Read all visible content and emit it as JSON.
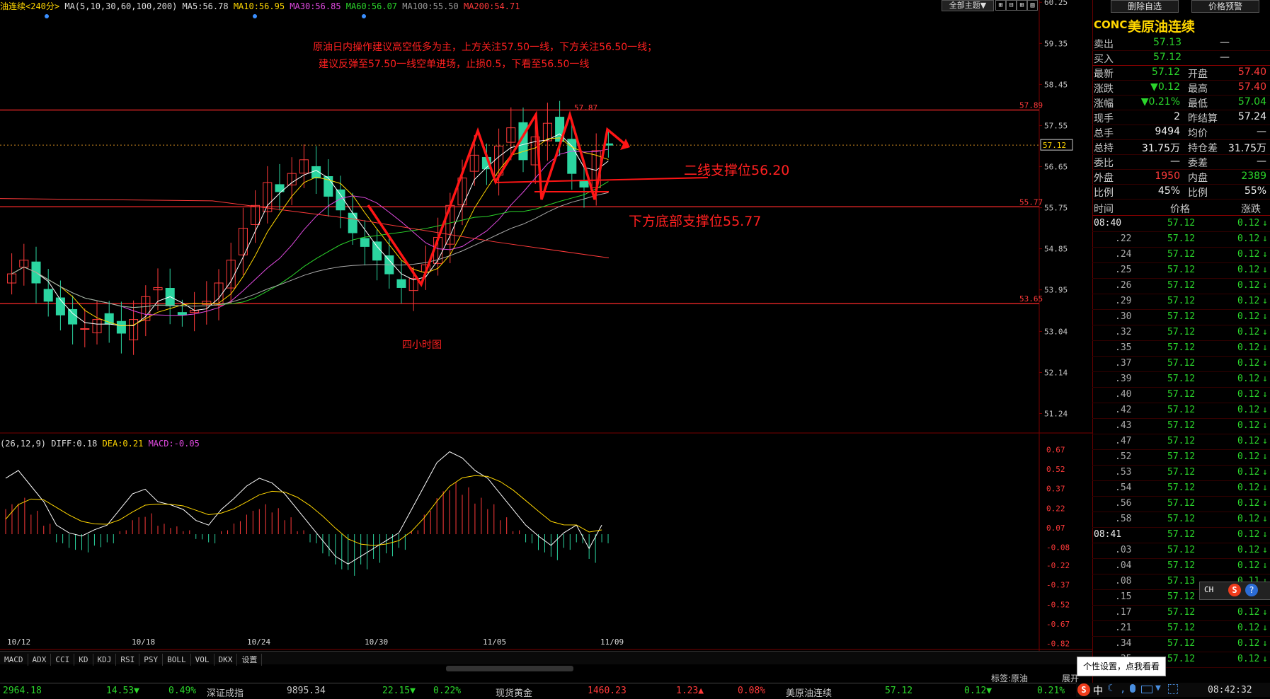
{
  "chart_header": {
    "name": "油连续<240分>",
    "ma_label": "MA(5,10,30,60,100,200)",
    "ma5": "MA5:56.78",
    "ma10": "MA10:56.95",
    "ma30": "MA30:56.85",
    "ma60": "MA60:56.07",
    "ma100": "MA100:55.50",
    "ma200": "MA200:54.71",
    "theme_btn": "全部主题▼"
  },
  "annotations": {
    "line1": "原油日内操作建议高空低多为主，上方关注57.50一线，下方关注56.50一线；",
    "line2": "建议反弹至57.50一线空单进场，止损0.5，下看至56.50一线",
    "support1": "二线支撑位56.20",
    "support2": "下方底部支撑位55.77",
    "chart_label": "四小时图",
    "high_label": "57.87"
  },
  "chart_data": [
    {
      "type": "candlestick",
      "title": "油连续<240分>",
      "yaxis_ticks": [
        "60.25",
        "59.35",
        "58.45",
        "57.55",
        "56.65",
        "55.75",
        "54.85",
        "53.95",
        "53.04",
        "52.14",
        "51.24"
      ],
      "xaxis_ticks": [
        "10/12",
        "10/18",
        "10/24",
        "10/30",
        "11/05",
        "11/09"
      ],
      "ylim": [
        51.0,
        60.3
      ],
      "hlines": [
        {
          "value": 57.89,
          "label": "57.89"
        },
        {
          "value": 55.77,
          "label": "55.77"
        },
        {
          "value": 53.65,
          "label": "53.65"
        }
      ],
      "last_price": "57.12",
      "close_series": [
        54.3,
        54.6,
        54.1,
        53.7,
        53.4,
        53.2,
        53.1,
        53.3,
        53.2,
        53.0,
        53.3,
        53.8,
        54.0,
        53.6,
        53.4,
        53.5,
        53.7,
        54.1,
        54.6,
        55.3,
        55.8,
        56.3,
        56.1,
        56.5,
        56.8,
        56.4,
        56.0,
        55.7,
        55.2,
        54.9,
        54.6,
        54.3,
        54.0,
        54.2,
        54.5,
        55.1,
        55.8,
        56.4,
        56.9,
        56.6,
        57.1,
        57.5,
        56.8,
        57.3,
        57.6,
        57.2,
        56.5,
        56.2,
        57.0,
        57.12
      ]
    },
    {
      "type": "bar",
      "title": "MACD",
      "series": [
        {
          "name": "MACD",
          "values": [
            0.25,
            0.3,
            0.2,
            0.1,
            -0.05,
            -0.1,
            -0.12,
            -0.08,
            -0.05,
            0.05,
            0.15,
            0.18,
            0.1,
            0.08,
            0.05,
            -0.02,
            -0.05,
            0.05,
            0.12,
            0.2,
            0.25,
            0.22,
            0.15,
            0.05,
            -0.05,
            -0.15,
            -0.25,
            -0.3,
            -0.25,
            -0.2,
            -0.15,
            -0.1,
            0.05,
            0.2,
            0.35,
            0.42,
            0.38,
            0.3,
            0.25,
            0.15,
            0.05,
            -0.05,
            -0.12,
            -0.18,
            -0.1,
            -0.05,
            -0.2,
            -0.05
          ]
        }
      ],
      "yaxis_ticks": [
        "0.67",
        "0.52",
        "0.37",
        "0.22",
        "0.07",
        "-0.08",
        "-0.22",
        "-0.37",
        "-0.52",
        "-0.67",
        "-0.82"
      ],
      "ylim": [
        -0.85,
        0.7
      ]
    }
  ],
  "macd_header": {
    "params": "(26,12,9)",
    "diff": "DIFF:0.18",
    "dea": "DEA:0.21",
    "macd": "MACD:-0.05"
  },
  "tabs": [
    "MACD",
    "ADX",
    "CCI",
    "KD",
    "KDJ",
    "RSI",
    "PSY",
    "BOLL",
    "VOL",
    "DKX",
    "设置"
  ],
  "sidebar": {
    "btn_delete": "删除自选",
    "btn_alert": "价格预警",
    "code": "CONC",
    "name": "美原油连续",
    "sell_label": "卖出",
    "sell_price": "57.13",
    "sell_vol": "—",
    "buy_label": "买入",
    "buy_price": "57.12",
    "buy_vol": "—",
    "quote": [
      {
        "l1": "最新",
        "v1": "57.12",
        "c1": "grn",
        "l2": "开盘",
        "v2": "57.40",
        "c2": "red"
      },
      {
        "l1": "涨跌",
        "v1": "▼0.12",
        "c1": "grn",
        "l2": "最高",
        "v2": "57.40",
        "c2": "red"
      },
      {
        "l1": "涨幅",
        "v1": "▼0.21%",
        "c1": "grn",
        "l2": "最低",
        "v2": "57.04",
        "c2": "grn"
      },
      {
        "l1": "现手",
        "v1": "2",
        "c1": "wht",
        "l2": "昨结算",
        "v2": "57.24",
        "c2": "wht"
      },
      {
        "l1": "总手",
        "v1": "9494",
        "c1": "wht",
        "l2": "均价",
        "v2": "—",
        "c2": "wht"
      },
      {
        "l1": "总持",
        "v1": "31.75万",
        "c1": "wht",
        "l2": "持仓差",
        "v2": "31.75万",
        "c2": "wht"
      },
      {
        "l1": "委比",
        "v1": "—",
        "c1": "wht",
        "l2": "委差",
        "v2": "—",
        "c2": "wht"
      },
      {
        "l1": "外盘",
        "v1": "1950",
        "c1": "red",
        "l2": "内盘",
        "v2": "2389",
        "c2": "grn"
      },
      {
        "l1": "比例",
        "v1": "45%",
        "c1": "wht",
        "l2": "比例",
        "v2": "55%",
        "c2": "wht"
      }
    ],
    "ticks_header": {
      "time": "时间",
      "price": "价格",
      "change": "涨跌"
    },
    "ticks": [
      {
        "t": "08:40",
        "p": "57.12",
        "c": "0.12"
      },
      {
        "t": ".22",
        "p": "57.12",
        "c": "0.12"
      },
      {
        "t": ".24",
        "p": "57.12",
        "c": "0.12"
      },
      {
        "t": ".25",
        "p": "57.12",
        "c": "0.12"
      },
      {
        "t": ".26",
        "p": "57.12",
        "c": "0.12"
      },
      {
        "t": ".29",
        "p": "57.12",
        "c": "0.12"
      },
      {
        "t": ".30",
        "p": "57.12",
        "c": "0.12"
      },
      {
        "t": ".32",
        "p": "57.12",
        "c": "0.12"
      },
      {
        "t": ".35",
        "p": "57.12",
        "c": "0.12"
      },
      {
        "t": ".37",
        "p": "57.12",
        "c": "0.12"
      },
      {
        "t": ".39",
        "p": "57.12",
        "c": "0.12"
      },
      {
        "t": ".40",
        "p": "57.12",
        "c": "0.12"
      },
      {
        "t": ".42",
        "p": "57.12",
        "c": "0.12"
      },
      {
        "t": ".43",
        "p": "57.12",
        "c": "0.12"
      },
      {
        "t": ".47",
        "p": "57.12",
        "c": "0.12"
      },
      {
        "t": ".52",
        "p": "57.12",
        "c": "0.12"
      },
      {
        "t": ".53",
        "p": "57.12",
        "c": "0.12"
      },
      {
        "t": ".54",
        "p": "57.12",
        "c": "0.12"
      },
      {
        "t": ".56",
        "p": "57.12",
        "c": "0.12"
      },
      {
        "t": ".58",
        "p": "57.12",
        "c": "0.12"
      },
      {
        "t": "08:41",
        "p": "57.12",
        "c": "0.12"
      },
      {
        "t": ".03",
        "p": "57.12",
        "c": "0.12"
      },
      {
        "t": ".04",
        "p": "57.12",
        "c": "0.12"
      },
      {
        "t": ".08",
        "p": "57.13",
        "c": "0.11"
      },
      {
        "t": ".15",
        "p": "57.12",
        "c": "0.12"
      },
      {
        "t": ".17",
        "p": "57.12",
        "c": "0.12"
      },
      {
        "t": ".21",
        "p": "57.12",
        "c": "0.12"
      },
      {
        "t": ".34",
        "p": "57.12",
        "c": "0.12"
      },
      {
        "t": ".35",
        "p": "57.12",
        "c": "0.12"
      }
    ]
  },
  "status": {
    "tag_label": "标签:原油",
    "expand": "展开",
    "tooltip": "个性设置，点我看看"
  },
  "ticker": [
    {
      "text": "2964.18",
      "color": "#2bd52b"
    },
    {
      "text": "14.53▼",
      "color": "#2bd52b"
    },
    {
      "text": "0.49%",
      "color": "#2bd52b"
    },
    {
      "text": "深证成指",
      "color": "#c8c8c8"
    },
    {
      "text": "9895.34",
      "color": "#c8c8c8"
    },
    {
      "text": "22.15▼",
      "color": "#2bd52b"
    },
    {
      "text": "0.22%",
      "color": "#2bd52b"
    },
    {
      "text": "现货黄金",
      "color": "#c8c8c8"
    },
    {
      "text": "1460.23",
      "color": "#ff3a3a"
    },
    {
      "text": "1.23▲",
      "color": "#ff3a3a"
    },
    {
      "text": "0.08%",
      "color": "#ff3a3a"
    },
    {
      "text": "美原油连续",
      "color": "#c8c8c8"
    },
    {
      "text": "57.12",
      "color": "#2bd52b"
    },
    {
      "text": "0.12▼",
      "color": "#2bd52b"
    },
    {
      "text": "0.21%",
      "color": "#2bd52b"
    }
  ],
  "clock": "08:42:32",
  "ime": {
    "ch": "CH",
    "s": "S",
    "q": "?"
  }
}
